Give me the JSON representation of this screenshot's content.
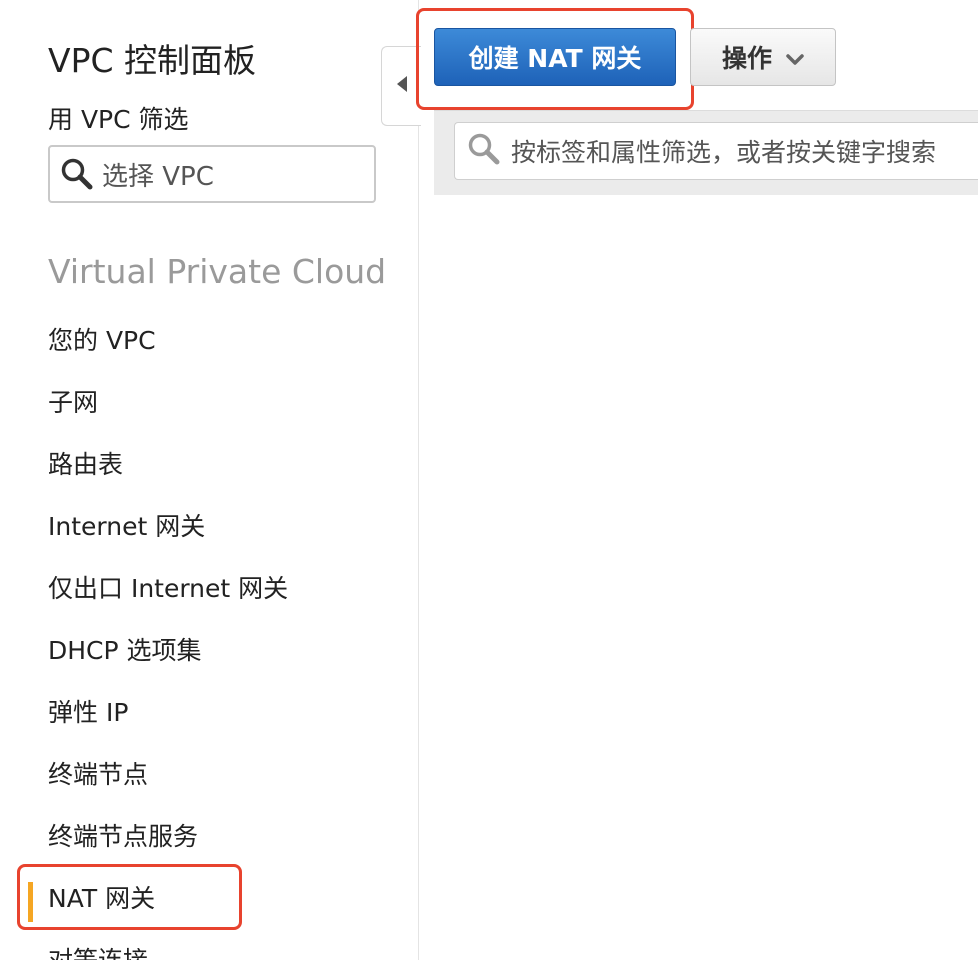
{
  "sidebar": {
    "title": "VPC 控制面板",
    "filter_label": "用 VPC 筛选",
    "vpc_select_placeholder": "选择 VPC",
    "section_title": "Virtual Private Cloud",
    "items": [
      {
        "label": "您的 VPC"
      },
      {
        "label": "子网"
      },
      {
        "label": "路由表"
      },
      {
        "label": "Internet 网关"
      },
      {
        "label": "仅出口 Internet 网关"
      },
      {
        "label": "DHCP 选项集"
      },
      {
        "label": "弹性 IP"
      },
      {
        "label": "终端节点"
      },
      {
        "label": "终端节点服务"
      },
      {
        "label": "NAT 网关"
      },
      {
        "label": "对等连接"
      }
    ],
    "active_item": "NAT 网关"
  },
  "toolbar": {
    "create_label": "创建 NAT 网关",
    "actions_label": "操作"
  },
  "search": {
    "placeholder": "按标签和属性筛选，或者按关键字搜索"
  },
  "colors": {
    "primary_button": "#2b72c7",
    "active_indicator": "#f5a623",
    "annotation_highlight": "#e8432e",
    "section_title": "#9a9a9a"
  },
  "icons": {
    "search": "magnifier-icon",
    "collapse": "caret-left-icon",
    "dropdown": "chevron-down-icon"
  }
}
